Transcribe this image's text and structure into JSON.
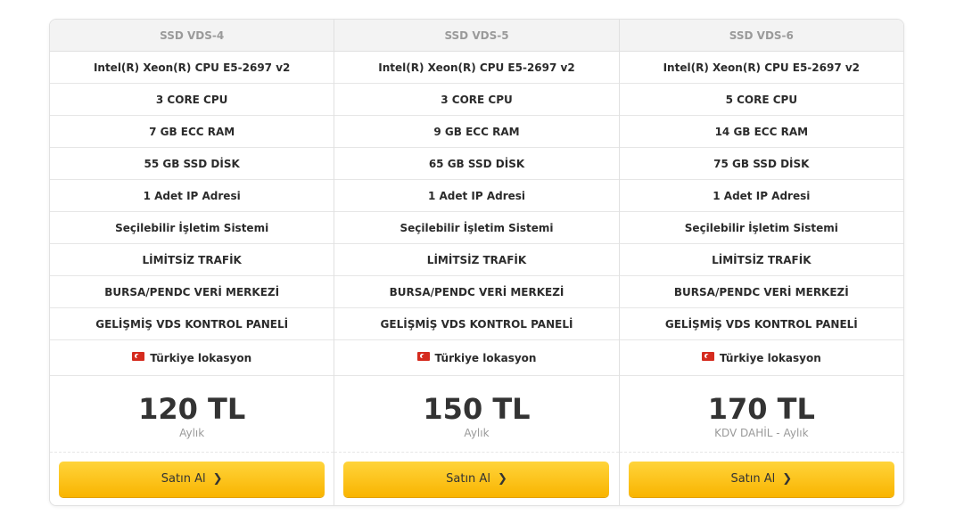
{
  "plans": [
    {
      "name": "SSD VDS-4",
      "features": [
        "Intel(R) Xeon(R) CPU E5-2697 v2",
        "3 CORE CPU",
        "7 GB ECC RAM",
        "55 GB SSD DİSK",
        "1 Adet IP Adresi",
        "Seçilebilir İşletim Sistemi",
        "LİMİTSİZ TRAFİK",
        "BURSA/PENDC VERİ MERKEZİ",
        "GELİŞMİŞ VDS KONTROL PANELİ"
      ],
      "location": "Türkiye lokasyon",
      "price": "120 TL",
      "period": "Aylık",
      "button": "Satın Al"
    },
    {
      "name": "SSD VDS-5",
      "features": [
        "Intel(R) Xeon(R) CPU E5-2697 v2",
        "3 CORE CPU",
        "9 GB ECC RAM",
        "65 GB SSD DİSK",
        "1 Adet IP Adresi",
        "Seçilebilir İşletim Sistemi",
        "LİMİTSİZ TRAFİK",
        "BURSA/PENDC VERİ MERKEZİ",
        "GELİŞMİŞ VDS KONTROL PANELİ"
      ],
      "location": "Türkiye lokasyon",
      "price": "150 TL",
      "period": "Aylık",
      "button": "Satın Al"
    },
    {
      "name": "SSD VDS-6",
      "features": [
        "Intel(R) Xeon(R) CPU E5-2697 v2",
        "5 CORE CPU",
        "14 GB ECC RAM",
        "75 GB SSD DİSK",
        "1 Adet IP Adresi",
        "Seçilebilir İşletim Sistemi",
        "LİMİTSİZ TRAFİK",
        "BURSA/PENDC VERİ MERKEZİ",
        "GELİŞMİŞ VDS KONTROL PANELİ"
      ],
      "location": "Türkiye lokasyon",
      "price": "170 TL",
      "period": "KDV DAHİL - Aylık",
      "button": "Satın Al"
    }
  ],
  "icons": {
    "flag": "turkey-flag-icon",
    "chevron": "chevron-right-icon"
  },
  "colors": {
    "button_top": "#ffd43b",
    "button_bottom": "#f9b400",
    "header_bg": "#f3f3f3"
  }
}
